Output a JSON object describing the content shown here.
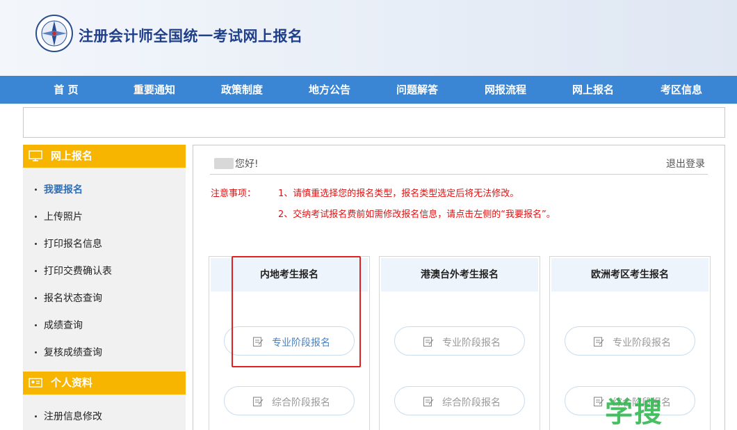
{
  "header": {
    "title": "注册会计师全国统一考试网上报名"
  },
  "nav": [
    {
      "label": "首 页"
    },
    {
      "label": "重要通知"
    },
    {
      "label": "政策制度"
    },
    {
      "label": "地方公告"
    },
    {
      "label": "问题解答"
    },
    {
      "label": "网报流程"
    },
    {
      "label": "网上报名"
    },
    {
      "label": "考区信息"
    }
  ],
  "sidebar": {
    "section1": "网上报名",
    "items": [
      "我要报名",
      "上传照片",
      "打印报名信息",
      "打印交费确认表",
      "报名状态查询",
      "成绩查询",
      "复核成绩查询"
    ],
    "section2": "个人资料",
    "items2": [
      "注册信息修改"
    ]
  },
  "main": {
    "greeting": "您好!",
    "logout": "退出登录",
    "note_label": "注意事项：",
    "note1": "1、请慎重选择您的报名类型，报名类型选定后将无法修改。",
    "note2": "2、交纳考试报名费前如需修改报名信息，请点击左侧的“我要报名”。",
    "cards": [
      {
        "title": "内地考生报名",
        "btn1": "专业阶段报名",
        "btn2": "综合阶段报名"
      },
      {
        "title": "港澳台外考生报名",
        "btn1": "专业阶段报名",
        "btn2": "综合阶段报名"
      },
      {
        "title": "欧洲考区考生报名",
        "btn1": "专业阶段报名",
        "btn2": "综合阶段报名"
      }
    ]
  },
  "watermark": "学搜",
  "colors": {
    "nav_bg": "#3a86d4",
    "sidebar_header": "#f7b500",
    "notice_red": "#e01010",
    "active_link": "#2e6fb8",
    "highlight_border": "#e02020"
  }
}
